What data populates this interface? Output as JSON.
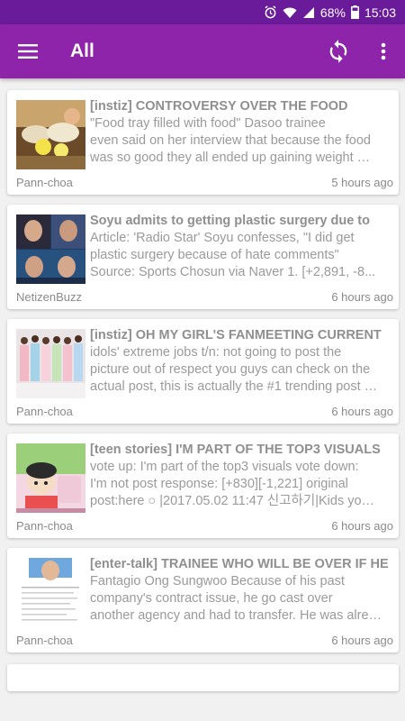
{
  "status_bar": {
    "battery": "68%",
    "time": "15:03"
  },
  "app_bar": {
    "title": "All"
  },
  "feed": [
    {
      "title": "[instiz] CONTROVERSY OVER THE FOOD",
      "lines": [
        "\"Food tray filled with food\"        Dasoo trainee",
        "even said on her interview that because the food",
        "was so good they all ended up gaining weight    …"
      ],
      "source": "Pann-choa",
      "time": "5 hours ago"
    },
    {
      "title": "Soyu admits to getting plastic surgery due to",
      "lines": [
        "Article: 'Radio Star' Soyu confesses, \"I did get",
        "plastic surgery because of hate comments\"",
        "Source: Sports Chosun via Naver  1. [+2,891, -8..."
      ],
      "source": "NetizenBuzz",
      "time": "6 hours ago"
    },
    {
      "title": "[instiz] OH MY GIRL'S FANMEETING CURRENT",
      "lines": [
        "idols' extreme jobs t/n: not going to post the",
        "picture out of respect you guys can check on the",
        "actual post, this is actually the #1 trending post …"
      ],
      "source": "Pann-choa",
      "time": "6 hours ago"
    },
    {
      "title": "[teen stories] I'M PART OF THE TOP3 VISUALS",
      "lines": [
        "vote up: I'm part of the top3 visuals vote down:",
        "I'm not  post response:  [+830][-1,221]  original",
        "post:here  ○ |2017.05.02 11:47 신고하기|Kids yo…"
      ],
      "source": "Pann-choa",
      "time": "6 hours ago"
    },
    {
      "title": "[enter-talk] TRAINEE WHO WILL BE OVER IF HE",
      "lines": [
        "Fantagio Ong Sungwoo Because of his past",
        "company's contract issue, he go cast over",
        "another agency and had to transfer. He was alre…"
      ],
      "source": "Pann-choa",
      "time": "6 hours ago"
    }
  ],
  "colors": {
    "status_bar": "#6a1b9a",
    "app_bar": "#8e24aa",
    "background": "#f1f1f1"
  }
}
